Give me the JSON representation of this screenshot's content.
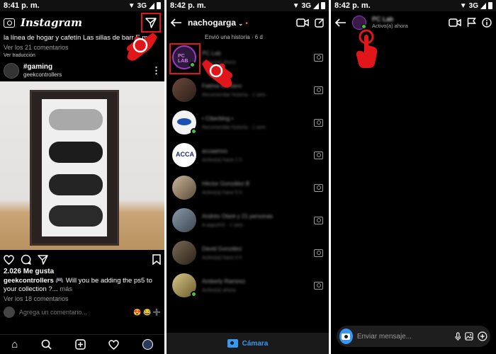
{
  "screen1": {
    "status": {
      "time": "8:41 p. m.",
      "network": "3G"
    },
    "logo": "Instagram",
    "caption_snippet": "la línea de hogar y cafetín Las sillas de barr E  mas",
    "view_comments_top": "Ver los 21 comentarios",
    "view_translation": "Ver traducción",
    "post": {
      "hashtag": "#gaming",
      "user": "geekcontrollers"
    },
    "likes": "2.026 Me gusta",
    "caption_user": "geekcontrollers",
    "caption_text": "🎮 Will you be adding the ps5 to your collection ?...",
    "caption_more": "más",
    "view_comments": "Ver los 18 comentarios",
    "comment_placeholder": "Agrega un comentario...",
    "reactions": "😍 😂 ➕"
  },
  "screen2": {
    "status": {
      "time": "8:42 p. m.",
      "network": "3G"
    },
    "username": "nachogarga",
    "story_line": "Envió una historia · 6 d",
    "conversations": [
      {
        "name": "PC Lab",
        "preview": "Activo(a) ahora",
        "online": true,
        "selected": true
      },
      {
        "name": "Fatima Montero",
        "preview": "Recomendar historia · 1 sem",
        "online": false
      },
      {
        "name": "• Ciberblog •",
        "preview": "Recomendar historia · 1 sem",
        "online": true
      },
      {
        "name": "accaamxs",
        "preview": "Activo(a) hace 1 h",
        "online": false
      },
      {
        "name": "Héctor González B",
        "preview": "Activo(a) hace 5 h",
        "online": false
      },
      {
        "name": "Andrés Otaré y 21 personas",
        "preview": "A aqaulXX · 1 sem",
        "online": false
      },
      {
        "name": "David González",
        "preview": "Activo(a) hace 4 h",
        "online": false
      },
      {
        "name": "Amberly Ramirez",
        "preview": "Activo(a) ahora",
        "online": true
      }
    ],
    "camera_label": "Cámara"
  },
  "screen3": {
    "status": {
      "time": "8:42 p. m.",
      "network": "3G"
    },
    "chat_name": "PC Lab",
    "chat_status": "Activo(a) ahora",
    "message_placeholder": "Enviar mensaje..."
  }
}
